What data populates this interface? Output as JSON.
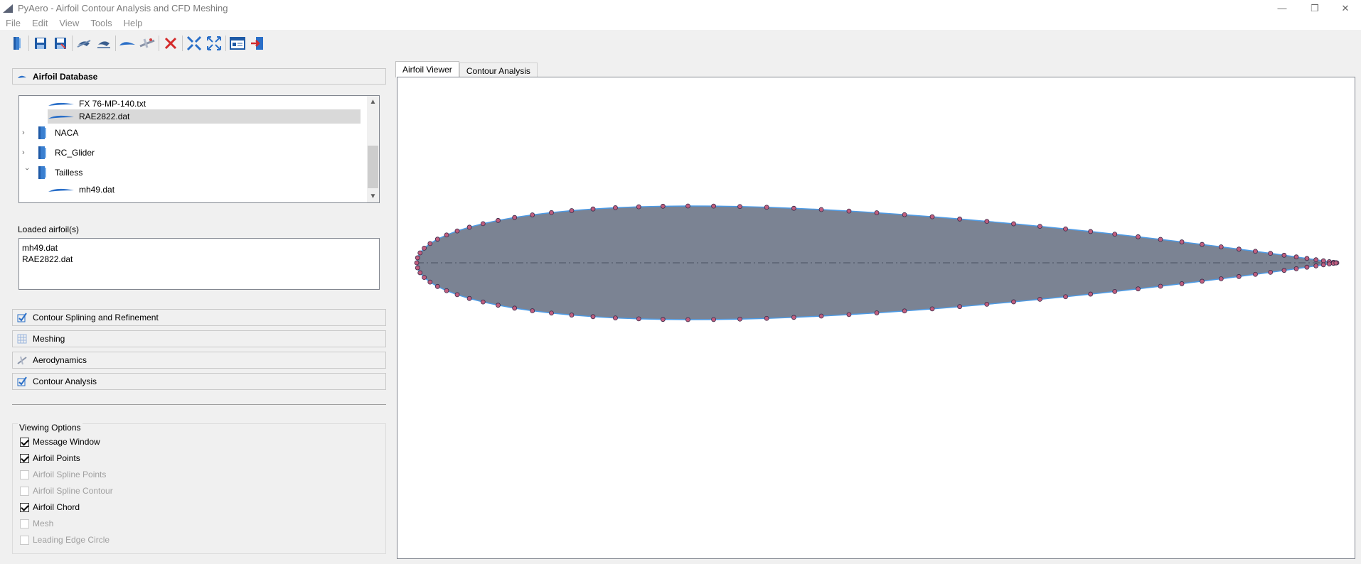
{
  "window": {
    "title": "PyAero - Airfoil Contour Analysis and CFD Meshing",
    "minimize": "—",
    "restore": "❐",
    "close": "✕"
  },
  "menu": [
    "File",
    "Edit",
    "View",
    "Tools",
    "Help"
  ],
  "toolbar": {
    "icons": [
      "open-folder-icon",
      "save-icon",
      "save-as-icon",
      "import-icon",
      "export-icon",
      "airfoil-icon",
      "aircraft-icon",
      "delete-icon",
      "zoom-in-icon",
      "fit-view-icon",
      "message-window-icon",
      "exit-icon"
    ]
  },
  "sidebar": {
    "airfoil_database": "Airfoil Database",
    "tree": [
      {
        "label": "FX 76-MP-140.txt",
        "type": "file"
      },
      {
        "label": "RAE2822.dat",
        "type": "file",
        "selected": true
      },
      {
        "label": "NACA",
        "type": "folder",
        "expanded": false
      },
      {
        "label": "RC_Glider",
        "type": "folder",
        "expanded": false
      },
      {
        "label": "Tailless",
        "type": "folder",
        "expanded": true
      },
      {
        "label": "mh49.dat",
        "type": "file"
      }
    ],
    "loaded_label": "Loaded airfoil(s)",
    "loaded": [
      "mh49.dat",
      "RAE2822.dat"
    ],
    "sections": [
      "Contour Splining and Refinement",
      "Meshing",
      "Aerodynamics",
      "Contour Analysis"
    ],
    "viewing_options": {
      "label": "Viewing Options",
      "items": [
        {
          "label": "Message Window",
          "checked": true,
          "enabled": true
        },
        {
          "label": "Airfoil Points",
          "checked": true,
          "enabled": true
        },
        {
          "label": "Airfoil Spline Points",
          "checked": false,
          "enabled": false
        },
        {
          "label": "Airfoil Spline Contour",
          "checked": false,
          "enabled": false
        },
        {
          "label": "Airfoil Chord",
          "checked": true,
          "enabled": true
        },
        {
          "label": "Mesh",
          "checked": false,
          "enabled": false
        },
        {
          "label": "Leading Edge Circle",
          "checked": false,
          "enabled": false
        }
      ]
    }
  },
  "tabs": [
    {
      "label": "Airfoil Viewer",
      "active": true
    },
    {
      "label": "Contour Analysis",
      "active": false
    }
  ],
  "viewer": {
    "airfoil": "mh49.dat",
    "fill_color": "#7b8393",
    "outline_color": "#4d9be6",
    "point_color": "#c05e7e",
    "chord_color": "#4a5060"
  }
}
